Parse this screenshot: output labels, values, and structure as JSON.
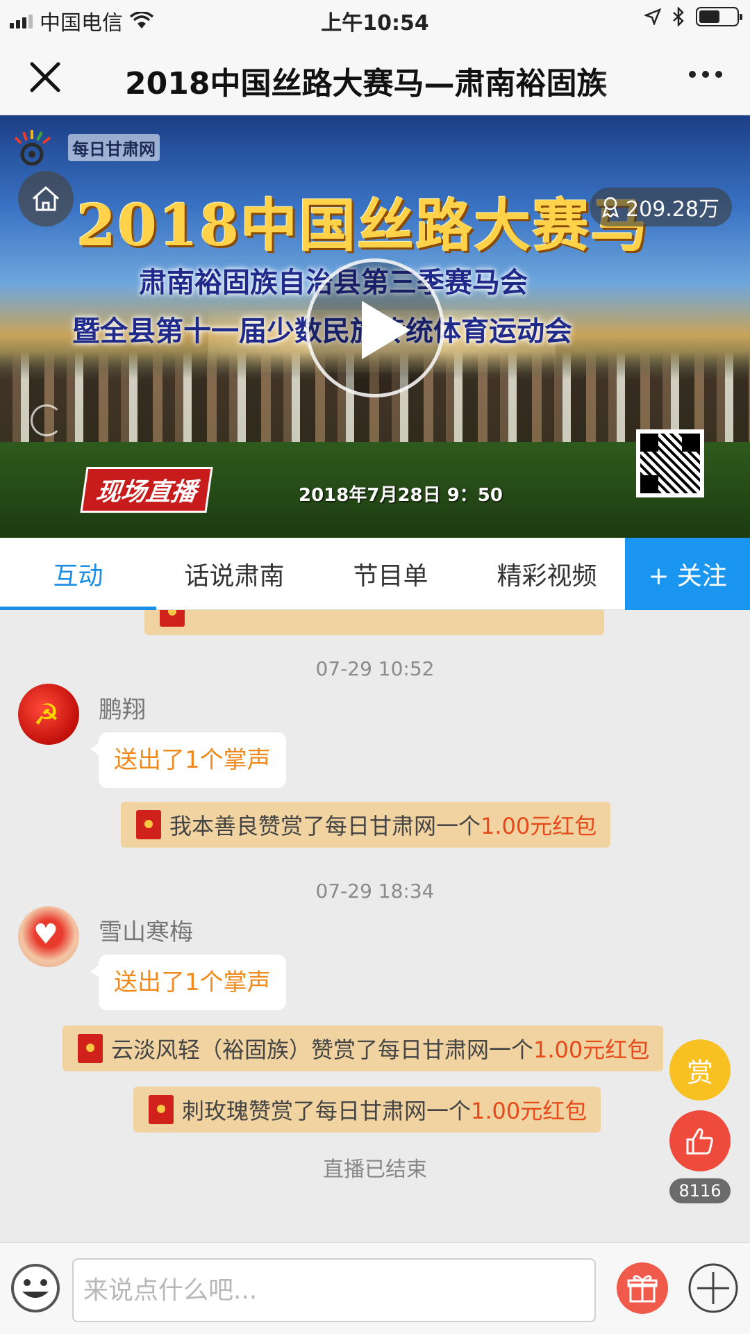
{
  "status_bar": {
    "carrier": "中国电信",
    "time": "上午10:54"
  },
  "nav": {
    "title": "2018中国丝路大赛马—肃南裕固族"
  },
  "banner": {
    "brand": "每日甘肃网",
    "headline": "2018中国丝路大赛马",
    "subline1": "肃南裕固族自治县第三季赛马会",
    "subline2": "暨全县第十一届少数民族传统体育运动会",
    "live_badge": "现场直播",
    "date": "2018年7月28日  9：50",
    "views": "209.28万"
  },
  "tabs": [
    {
      "label": "互动",
      "active": true
    },
    {
      "label": "话说肃南",
      "active": false
    },
    {
      "label": "节目单",
      "active": false
    },
    {
      "label": "精彩视频",
      "active": false
    }
  ],
  "follow_label": "+ 关注",
  "chat": {
    "time1": "07-29 10:52",
    "user1": {
      "name": "鹏翔",
      "message": "送出了1个掌声"
    },
    "reward1": {
      "text": "我本善良赞赏了每日甘肃网一个",
      "amount": "1.00元红包"
    },
    "time2": "07-29 18:34",
    "user2": {
      "name": "雪山寒梅",
      "message": "送出了1个掌声"
    },
    "reward2": {
      "text": "云淡风轻（裕固族）赞赏了每日甘肃网一个",
      "amount": "1.00元红包"
    },
    "reward3": {
      "text": "刺玫瑰赞赏了每日甘肃网一个",
      "amount": "1.00元红包"
    },
    "ended": "直播已结束"
  },
  "floating": {
    "reward_label": "赏",
    "like_count": "8116"
  },
  "input": {
    "placeholder": "来说点什么吧..."
  },
  "colors": {
    "accent_blue": "#1a8ee6",
    "reward_bg": "#f0d3a0",
    "amount_red": "#e64a1a",
    "bubble_text": "#f08a1c"
  }
}
